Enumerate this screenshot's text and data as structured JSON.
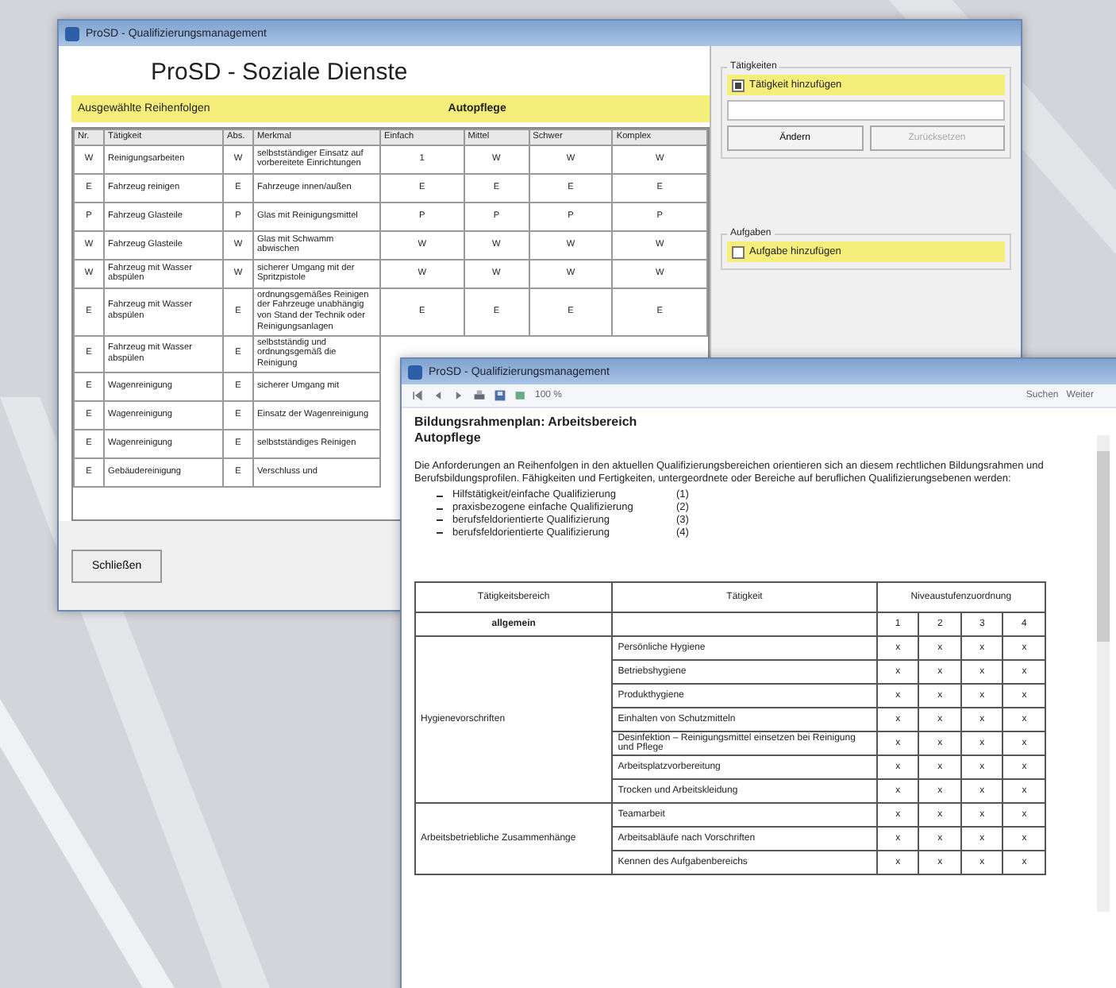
{
  "main_window": {
    "title": "ProSD - Qualifizierungsmanagement",
    "heading": "ProSD - Soziale Dienste",
    "bar": {
      "left": "Ausgewählte Reihenfolgen",
      "center": "Autopflege"
    },
    "table": {
      "columns": [
        "Nr.",
        "Tätigkeit",
        "Abs.",
        "Merkmal",
        "Einfach",
        "Mittel",
        "Schwer",
        "Komplex"
      ],
      "rows": [
        {
          "cells": [
            "W",
            "Reinigungsarbeiten",
            "W",
            "selbstständiger Einsatz auf vorbereitete Einrichtungen",
            "1",
            "W",
            "W",
            "W"
          ]
        },
        {
          "cells": [
            "E",
            "Fahrzeug reinigen",
            "E",
            "Fahrzeuge innen/außen",
            "E",
            "E",
            "E",
            "E"
          ]
        },
        {
          "cells": [
            "P",
            "Fahrzeug Glasteile",
            "P",
            "Glas mit Reinigungsmittel",
            "P",
            "P",
            "P",
            "P"
          ]
        },
        {
          "cells": [
            "W",
            "Fahrzeug Glasteile",
            "W",
            "Glas mit Schwamm abwischen",
            "W",
            "W",
            "W",
            "W"
          ]
        },
        {
          "cells": [
            "W",
            "Fahrzeug mit Wasser abspülen",
            "W",
            "sicherer Umgang mit der Spritzpistole",
            "W",
            "W",
            "W",
            "W"
          ]
        },
        {
          "cells": [
            "E",
            "Fahrzeug mit Wasser abspülen",
            "E",
            "ordnungsgemäßes Reinigen der Fahrzeuge unabhängig von Stand der Technik oder Reinigungsanlagen",
            "E",
            "E",
            "E",
            "E"
          ]
        },
        {
          "cells": [
            "E",
            "Fahrzeug mit Wasser abspülen",
            "E",
            "selbstständig und ordnungsgemäß die Reinigung"
          ]
        },
        {
          "cells": [
            "E",
            "Wagenreinigung",
            "E",
            "sicherer Umgang mit"
          ]
        },
        {
          "cells": [
            "E",
            "Wagenreinigung",
            "E",
            "Einsatz der Wagenreinigung"
          ]
        },
        {
          "cells": [
            "E",
            "Wagenreinigung",
            "E",
            "selbstständiges Reinigen"
          ]
        },
        {
          "cells": [
            "E",
            "Gebäudereinigung",
            "E",
            "Verschluss und"
          ]
        }
      ]
    },
    "close_button": "Schließen",
    "panel_top": {
      "legend": "Tätigkeiten",
      "option": {
        "label": "Tätigkeit hinzufügen",
        "checked": true
      },
      "buttons": [
        "Ändern",
        "Zurücksetzen"
      ]
    },
    "panel_bottom": {
      "legend": "Aufgaben",
      "option": {
        "label": "Aufgabe hinzufügen",
        "checked": false
      }
    }
  },
  "doc_window": {
    "title": "ProSD - Qualifizierungsmanagement",
    "zoom": "100 %",
    "toolbar_right": [
      "Suchen",
      "Weiter"
    ],
    "heading": [
      "Bildungsrahmenplan: Arbeitsbereich",
      "Autopflege"
    ],
    "intro": "Die Anforderungen an Reihenfolgen in den aktuellen Qualifizierungsbereichen orientieren sich an diesem rechtlichen Bildungsrahmen und Berufsbildungsprofilen. Fähigkeiten und Fertigkeiten, untergeordnete oder Bereiche auf beruflichen Qualifizierungsebenen werden:",
    "levels": [
      {
        "label": "Hilfstätigkeit/einfache Qualifizierung",
        "code": "(1)"
      },
      {
        "label": "praxisbezogene einfache Qualifizierung",
        "code": "(2)"
      },
      {
        "label": "berufsfeldorientierte Qualifizierung",
        "code": "(3)"
      },
      {
        "label": "berufsfeldorientierte Qualifizierung",
        "code": "(4)"
      }
    ],
    "table": {
      "columns": [
        "Tätigkeitsbereich",
        "Tätigkeit",
        "Niveaustufenzuordnung"
      ],
      "levels": [
        "1",
        "2",
        "3",
        "4"
      ],
      "general": "allgemein",
      "groups": [
        {
          "area": "Hygienevorschriften",
          "items": [
            {
              "task": "Persönliche Hygiene",
              "marks": [
                "x",
                "x",
                "x",
                "x"
              ]
            },
            {
              "task": "Betriebshygiene",
              "marks": [
                "x",
                "x",
                "x",
                "x"
              ]
            },
            {
              "task": "Produkthygiene",
              "marks": [
                "x",
                "x",
                "x",
                "x"
              ]
            },
            {
              "task": "Einhalten von Schutzmitteln",
              "marks": [
                "x",
                "x",
                "x",
                "x"
              ]
            },
            {
              "task": "Desinfektion – Reinigungsmittel einsetzen bei Reinigung und Pflege",
              "marks": [
                "x",
                "x",
                "x",
                "x"
              ]
            },
            {
              "task": "Arbeitsplatzvorbereitung",
              "marks": [
                "x",
                "x",
                "x",
                "x"
              ]
            },
            {
              "task": "Trocken und Arbeitskleidung",
              "marks": [
                "x",
                "x",
                "x",
                "x"
              ]
            }
          ]
        },
        {
          "area": "Arbeitsbetriebliche Zusammenhänge",
          "items": [
            {
              "task": "Teamarbeit",
              "marks": [
                "x",
                "x",
                "x",
                "x"
              ]
            },
            {
              "task": "Arbeitsabläufe nach Vorschriften",
              "marks": [
                "x",
                "x",
                "x",
                "x"
              ]
            },
            {
              "task": "Kennen des Aufgabenbereichs",
              "marks": [
                "x",
                "x",
                "x",
                "x"
              ]
            }
          ]
        }
      ]
    }
  }
}
